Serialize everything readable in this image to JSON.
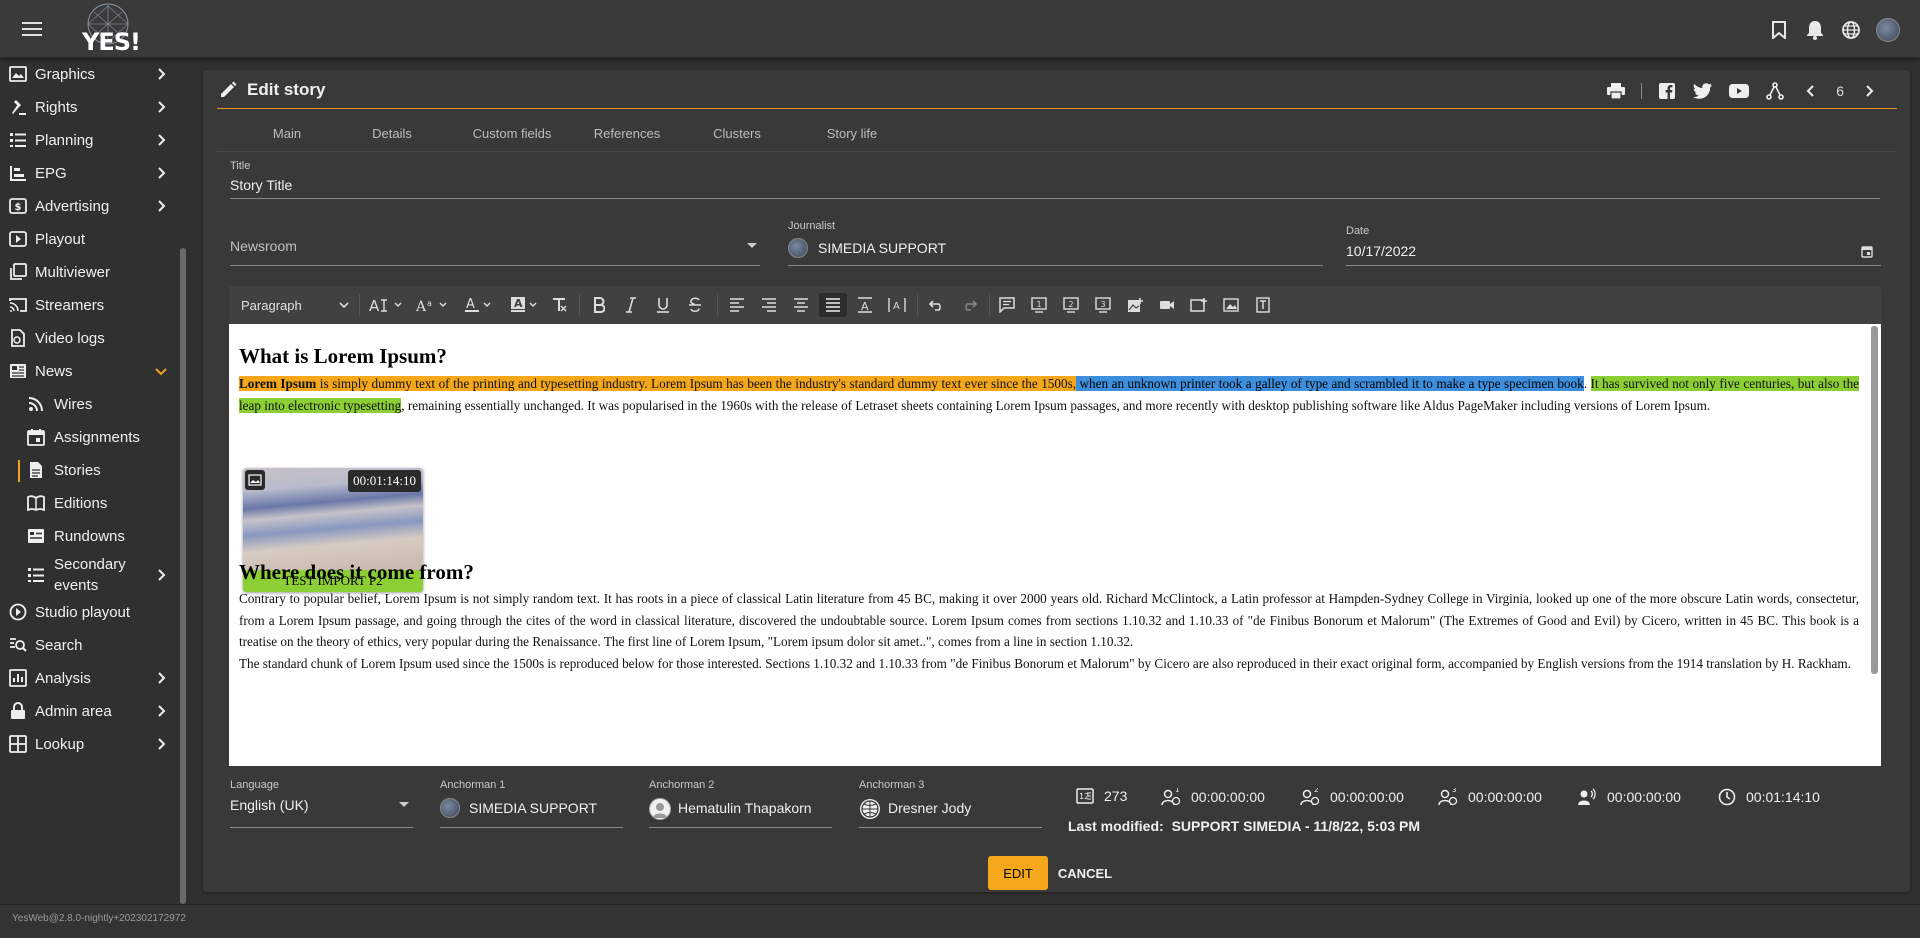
{
  "app": {
    "logo_text": "YES!",
    "version": "YesWeb@2.8.0-nightly+202302172972"
  },
  "topbar": {
    "icons": [
      "bookmark-icon",
      "bell-icon",
      "globe-icon",
      "user-avatar"
    ]
  },
  "sidebar": {
    "items": [
      {
        "label": "Graphics",
        "icon": "image-icon",
        "has_chevron": true
      },
      {
        "label": "Rights",
        "icon": "gavel-icon",
        "has_chevron": true
      },
      {
        "label": "Planning",
        "icon": "list-icon",
        "has_chevron": true
      },
      {
        "label": "EPG",
        "icon": "bar-chart-icon",
        "has_chevron": true
      },
      {
        "label": "Advertising",
        "icon": "dollar-icon",
        "has_chevron": true
      },
      {
        "label": "Playout",
        "icon": "play-icon",
        "has_chevron": false
      },
      {
        "label": "Multiviewer",
        "icon": "library-icon",
        "has_chevron": false
      },
      {
        "label": "Streamers",
        "icon": "cast-icon",
        "has_chevron": false
      },
      {
        "label": "Video logs",
        "icon": "video-log-icon",
        "has_chevron": false
      },
      {
        "label": "News",
        "icon": "news-icon",
        "has_chevron": true,
        "expanded": true
      },
      {
        "label": "Wires",
        "icon": "rss-icon",
        "sub": true
      },
      {
        "label": "Assignments",
        "icon": "calendar-icon",
        "sub": true
      },
      {
        "label": "Stories",
        "icon": "document-icon",
        "sub": true,
        "active": true
      },
      {
        "label": "Editions",
        "icon": "book-icon",
        "sub": true
      },
      {
        "label": "Rundowns",
        "icon": "rundown-icon",
        "sub": true
      },
      {
        "label": "Secondary events",
        "icon": "list-icon",
        "sub": true,
        "has_chevron": true
      },
      {
        "label": "Studio playout",
        "icon": "play-circle-icon",
        "has_chevron": false
      },
      {
        "label": "Search",
        "icon": "search-icon",
        "has_chevron": false
      },
      {
        "label": "Analysis",
        "icon": "analytics-icon",
        "has_chevron": true
      },
      {
        "label": "Admin area",
        "icon": "lock-icon",
        "has_chevron": true
      },
      {
        "label": "Lookup",
        "icon": "table-icon",
        "has_chevron": true
      }
    ]
  },
  "card": {
    "title": "Edit story",
    "pager_value": "6",
    "tabs": [
      "Main",
      "Details",
      "Custom fields",
      "References",
      "Clusters",
      "Story life"
    ]
  },
  "form": {
    "title_label": "Title",
    "title_value": "Story Title",
    "newsroom_placeholder": "Newsroom",
    "journalist_label": "Journalist",
    "journalist_value": "SIMEDIA SUPPORT",
    "date_label": "Date",
    "date_value": "10/17/2022"
  },
  "toolbar": {
    "paragraph_value": "Paragraph"
  },
  "editor": {
    "h1": "What is Lorem Ipsum?",
    "p1_bold": "Lorem Ipsum",
    "p1_orange": " is simply dummy text of the printing and typesetting industry. Lorem Ipsum has been the industry's standard dummy text ever since the 1500s,",
    "p1_blue": " when an unknown printer took a galley of type and scrambled it to make a type specimen book",
    "p1_mid": ". ",
    "p1_green": "It has survived not only five centuries, but also the leap into electronic typesetting",
    "p1_rest": ", remaining essentially unchanged. It was popularised in the 1960s with the release of Letraset sheets containing Lorem Ipsum passages, and more recently with desktop publishing software like Aldus PageMaker including versions of Lorem Ipsum.",
    "media_timecode": "00:01:14:10",
    "media_caption": "TEST IMPORT P2",
    "h2": "Where does it come from?",
    "p2": "Contrary to popular belief, Lorem Ipsum is not simply random text. It has roots in a piece of classical Latin literature from 45 BC, making it over 2000 years old. Richard McClintock, a Latin professor at Hampden-Sydney College in Virginia, looked up one of the more obscure Latin words, consectetur, from a Lorem Ipsum passage, and going through the cites of the word in classical literature, discovered the undoubtable source. Lorem Ipsum comes from sections 1.10.32 and 1.10.33 of \"de Finibus Bonorum et Malorum\" (The Extremes of Good and Evil) by Cicero, written in 45 BC. This book is a treatise on the theory of ethics, very popular during the Renaissance. The first line of Lorem Ipsum, \"Lorem ipsum dolor sit amet..\", comes from a line in section 1.10.32.",
    "p3": "The standard chunk of Lorem Ipsum used since the 1500s is reproduced below for those interested. Sections 1.10.32 and 1.10.33 from \"de Finibus Bonorum et Malorum\" by Cicero are also reproduced in their exact original form, accompanied by English versions from the 1914 translation by H. Rackham."
  },
  "bottom": {
    "language_label": "Language",
    "language_value": "English (UK)",
    "anchor1_label": "Anchorman 1",
    "anchor1_value": "SIMEDIA SUPPORT",
    "anchor2_label": "Anchorman 2",
    "anchor2_value": "Hematulin Thapakorn",
    "anchor3_label": "Anchorman 3",
    "anchor3_value": "Dresner Jody",
    "word_count": "273",
    "time1": "00:00:00:00",
    "time2": "00:00:00:00",
    "time3": "00:00:00:00",
    "time_voice": "00:00:00:00",
    "time_total": "00:01:14:10",
    "last_modified_label": "Last modified:",
    "last_modified_value": "SUPPORT SIMEDIA - 11/8/22, 5:03 PM",
    "edit_label": "EDIT",
    "cancel_label": "CANCEL"
  },
  "colors": {
    "accent": "#f5a71c",
    "highlight_orange": "#f5a71c",
    "highlight_blue": "#3d8fde",
    "highlight_green": "#8ccf34"
  }
}
